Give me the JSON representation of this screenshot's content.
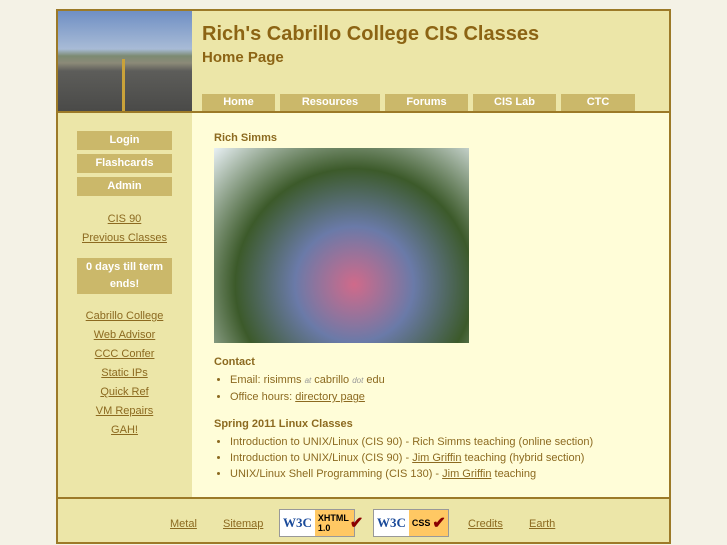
{
  "header": {
    "title": "Rich's Cabrillo College CIS Classes",
    "subtitle": "Home Page"
  },
  "tabs": [
    "Home",
    "Resources",
    "Forums",
    "CIS Lab",
    "CTC"
  ],
  "sidebar": {
    "buttons": [
      "Login",
      "Flashcards",
      "Admin"
    ],
    "links1": [
      "CIS 90",
      "Previous Classes"
    ],
    "countdown": "0 days till term ends!",
    "links2": [
      "Cabrillo College",
      "Web Advisor",
      "CCC Confer",
      "Static IPs",
      "Quick Ref",
      "VM Repairs",
      "GAH!"
    ]
  },
  "main": {
    "name": "Rich Simms",
    "contact_heading": "Contact",
    "email": {
      "label": "Email: risimms",
      "at": "at",
      "domain": "cabrillo",
      "dot": "dot",
      "tld": "edu"
    },
    "office": {
      "label": "Office hours: ",
      "link": "directory page"
    },
    "classes_heading": "Spring 2011 Linux Classes",
    "classes": [
      {
        "pre": "Introduction to UNIX/Linux (CIS 90) - Rich Simms teaching (online section)",
        "link": "",
        "post": ""
      },
      {
        "pre": "Introduction to UNIX/Linux (CIS 90) - ",
        "link": "Jim Griffin",
        "post": " teaching (hybrid section)"
      },
      {
        "pre": "UNIX/Linux Shell Programming (CIS 130) - ",
        "link": "Jim Griffin",
        "post": " teaching"
      }
    ]
  },
  "footer": {
    "links": [
      "Metal",
      "Sitemap",
      "Credits",
      "Earth"
    ],
    "badges": {
      "xhtml": {
        "w3c": "W3C",
        "label": "XHTML 1.0"
      },
      "css": {
        "w3c": "W3C",
        "label": "CSS"
      }
    }
  }
}
